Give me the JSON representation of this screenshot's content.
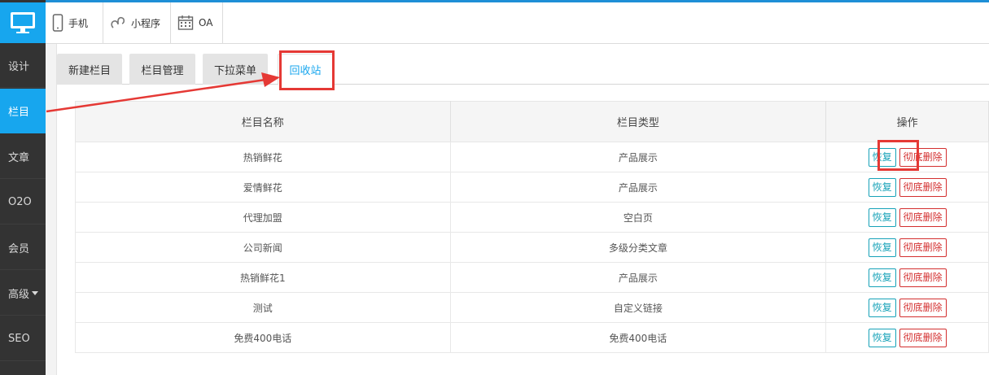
{
  "sidebar": {
    "items": [
      {
        "label": "设计"
      },
      {
        "label": "栏目"
      },
      {
        "label": "文章"
      },
      {
        "label": "O2O"
      },
      {
        "label": "会员"
      },
      {
        "label": "高级"
      },
      {
        "label": "SEO"
      }
    ]
  },
  "topbar": {
    "items": [
      {
        "label": "手机",
        "icon": "phone-icon"
      },
      {
        "label": "小程序",
        "icon": "mini-program-icon"
      },
      {
        "label": "OA",
        "icon": "calendar-icon"
      }
    ]
  },
  "tabs": [
    {
      "label": "新建栏目"
    },
    {
      "label": "栏目管理"
    },
    {
      "label": "下拉菜单"
    },
    {
      "label": "回收站"
    }
  ],
  "table": {
    "headers": [
      "栏目名称",
      "栏目类型",
      "操作"
    ],
    "restore_label": "恢复",
    "delete_label": "彻底删除",
    "rows": [
      {
        "name": "热销鲜花",
        "type": "产品展示"
      },
      {
        "name": "爱情鲜花",
        "type": "产品展示"
      },
      {
        "name": "代理加盟",
        "type": "空白页"
      },
      {
        "name": "公司新闻",
        "type": "多级分类文章"
      },
      {
        "name": "热销鲜花1",
        "type": "产品展示"
      },
      {
        "name": "测试",
        "type": "自定义链接"
      },
      {
        "name": "免费400电话",
        "type": "免费400电话"
      }
    ]
  },
  "colors": {
    "accent": "#17a6ee",
    "sidebar_bg": "#333333",
    "highlight": "#e53935",
    "restore": "#17a2b8",
    "delete": "#d32f2f"
  }
}
